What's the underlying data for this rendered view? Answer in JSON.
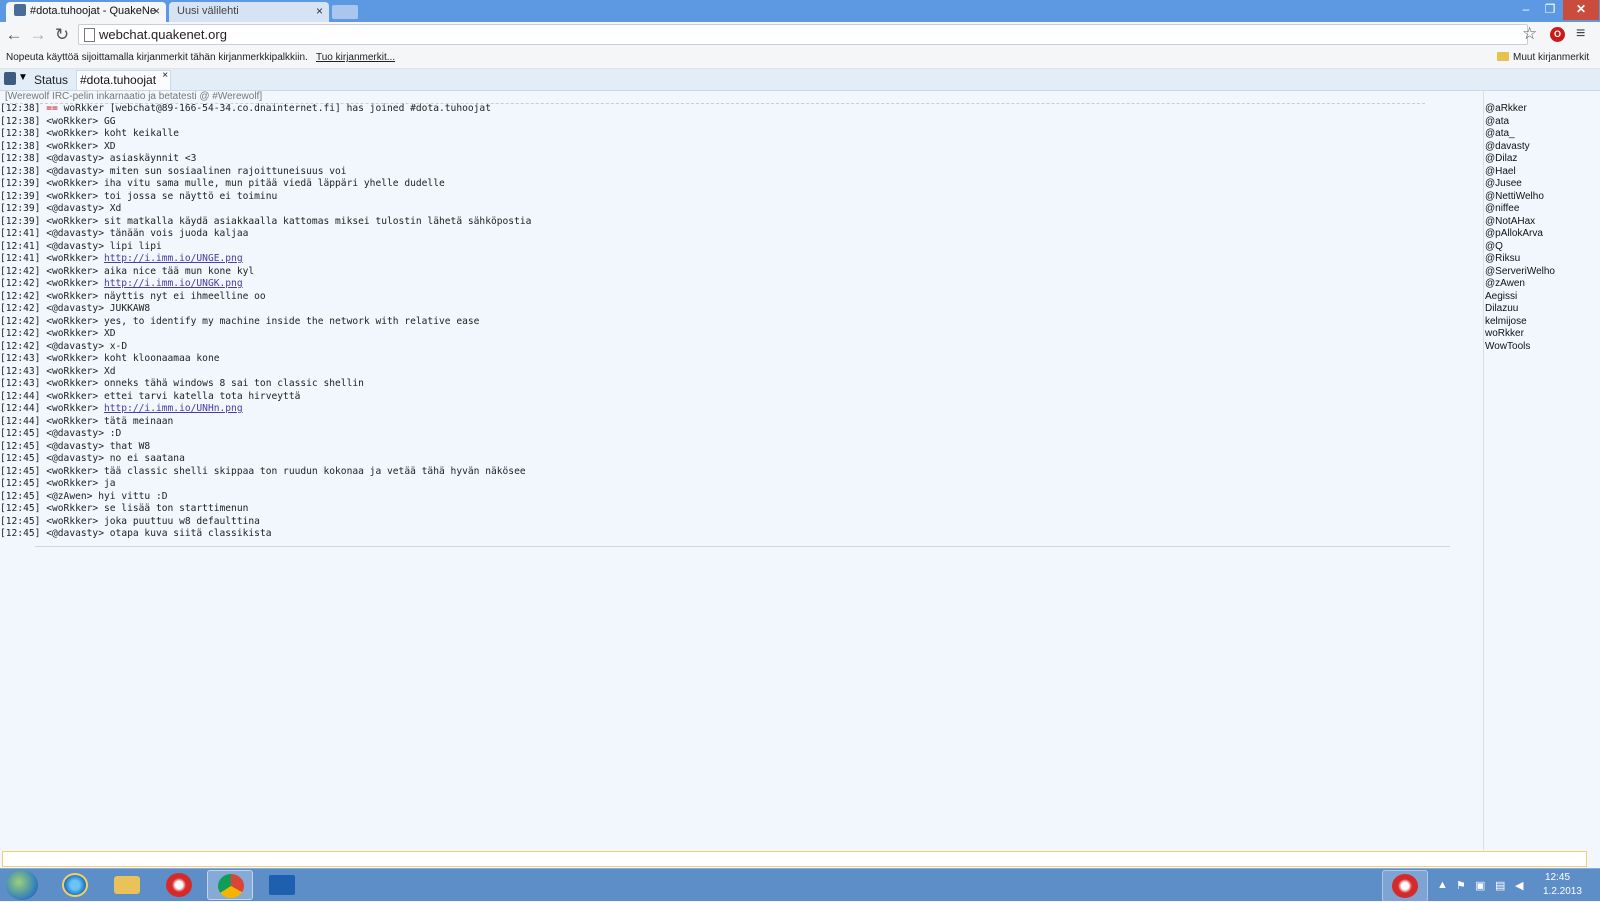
{
  "browser": {
    "tabs": [
      {
        "title": "#dota.tuhoojat - QuakeNe",
        "active": true
      },
      {
        "title": "Uusi välilehti",
        "active": false
      }
    ],
    "url": "webchat.quakenet.org",
    "bookmarks_hint": "Nopeuta käyttöä sijoittamalla kirjanmerkit tähän kirjanmerkkipalkkiin.",
    "bookmarks_import": "Tuo kirjanmerkit...",
    "other_bookmarks": "Muut kirjanmerkit",
    "close_glyph": "×"
  },
  "chat": {
    "tabs": [
      "Status",
      "#dota.tuhoojat"
    ],
    "topic": "[Werewolf IRC-pelin inkarnaatio ja betatesti @ #Werewolf]",
    "messages": [
      {
        "time": "[12:38]",
        "nick": "==",
        "text": "woRkker [webchat@89-166-54-34.co.dnainternet.fi] has joined #dota.tuhoojat"
      },
      {
        "time": "[12:38]",
        "nick": "<woRkker>",
        "text": "GG"
      },
      {
        "time": "[12:38]",
        "nick": "<woRkker>",
        "text": "koht keikalle"
      },
      {
        "time": "[12:38]",
        "nick": "<woRkker>",
        "text": "XD"
      },
      {
        "time": "[12:38]",
        "nick": "<@davasty>",
        "text": "asiaskäynnit <3"
      },
      {
        "time": "[12:38]",
        "nick": "<@davasty>",
        "text": "miten sun sosiaalinen rajoittuneisuus voi"
      },
      {
        "time": "[12:39]",
        "nick": "<woRkker>",
        "text": "iha vitu sama mulle, mun pitää viedä läppäri yhelle dudelle"
      },
      {
        "time": "[12:39]",
        "nick": "<woRkker>",
        "text": "toi jossa se näyttö ei toiminu"
      },
      {
        "time": "[12:39]",
        "nick": "<@davasty>",
        "text": "Xd"
      },
      {
        "time": "[12:39]",
        "nick": "<woRkker>",
        "text": "sit matkalla käydä asiakkaalla kattomas miksei tulostin lähetä sähköpostia"
      },
      {
        "time": "[12:41]",
        "nick": "<@davasty>",
        "text": "tänään vois juoda kaljaa"
      },
      {
        "time": "[12:41]",
        "nick": "<@davasty>",
        "text": "lipi lipi"
      },
      {
        "time": "[12:41]",
        "nick": "<woRkker>",
        "text": "http://i.imm.io/UNGE.png"
      },
      {
        "time": "[12:42]",
        "nick": "<woRkker>",
        "text": "aika nice tää mun kone kyl"
      },
      {
        "time": "[12:42]",
        "nick": "<woRkker>",
        "text": "http://i.imm.io/UNGK.png"
      },
      {
        "time": "[12:42]",
        "nick": "<woRkker>",
        "text": "näyttis nyt ei ihmeelline oo"
      },
      {
        "time": "[12:42]",
        "nick": "<@davasty>",
        "text": "JUKKAW8"
      },
      {
        "time": "[12:42]",
        "nick": "<woRkker>",
        "text": "yes, to identify my machine inside the network with relative ease"
      },
      {
        "time": "[12:42]",
        "nick": "<woRkker>",
        "text": "XD"
      },
      {
        "time": "[12:42]",
        "nick": "<@davasty>",
        "text": "x-D"
      },
      {
        "time": "[12:43]",
        "nick": "<woRkker>",
        "text": "koht kloonaamaa kone"
      },
      {
        "time": "[12:43]",
        "nick": "<woRkker>",
        "text": "Xd"
      },
      {
        "time": "[12:43]",
        "nick": "<woRkker>",
        "text": "onneks tähä windows 8 sai ton classic shellin"
      },
      {
        "time": "[12:44]",
        "nick": "<woRkker>",
        "text": "ettei tarvi katella tota hirveyttä"
      },
      {
        "time": "[12:44]",
        "nick": "<woRkker>",
        "text": "http://i.imm.io/UNHn.png"
      },
      {
        "time": "[12:44]",
        "nick": "<woRkker>",
        "text": "tätä meinaan"
      },
      {
        "time": "[12:45]",
        "nick": "<@davasty>",
        "text": ":D"
      },
      {
        "time": "[12:45]",
        "nick": "<@davasty>",
        "text": "that W8"
      },
      {
        "time": "[12:45]",
        "nick": "<@davasty>",
        "text": "no ei saatana"
      },
      {
        "time": "[12:45]",
        "nick": "<woRkker>",
        "text": "tää classic shelli skippaa ton ruudun kokonaa ja vetää tähä hyvän näkösee"
      },
      {
        "time": "[12:45]",
        "nick": "<woRkker>",
        "text": "ja"
      },
      {
        "time": "[12:45]",
        "nick": "<@zAwen>",
        "text": "hyi vittu :D"
      },
      {
        "time": "[12:45]",
        "nick": "<woRkker>",
        "text": "se lisää ton starttimenun"
      },
      {
        "time": "[12:45]",
        "nick": "<woRkker>",
        "text": "joka puuttuu w8 defaulttina"
      },
      {
        "time": "[12:45]",
        "nick": "<@davasty>",
        "text": "otapa kuva siitä classikista"
      }
    ],
    "nicklist": [
      "@aRkker",
      "@ata",
      "@ata_",
      "@davasty",
      "@Dilaz",
      "@Hael",
      "@Jusee",
      "@NettiWelho",
      "@niffee",
      "@NotAHax",
      "@pAllokArva",
      "@Q",
      "@Riksu",
      "@ServeriWelho",
      "@zAwen",
      "Aegissi",
      "Dilazuu",
      "kelmijose",
      "woRkker",
      "WowTools"
    ]
  },
  "taskbar": {
    "time": "12:45",
    "date": "1.2.2013"
  }
}
